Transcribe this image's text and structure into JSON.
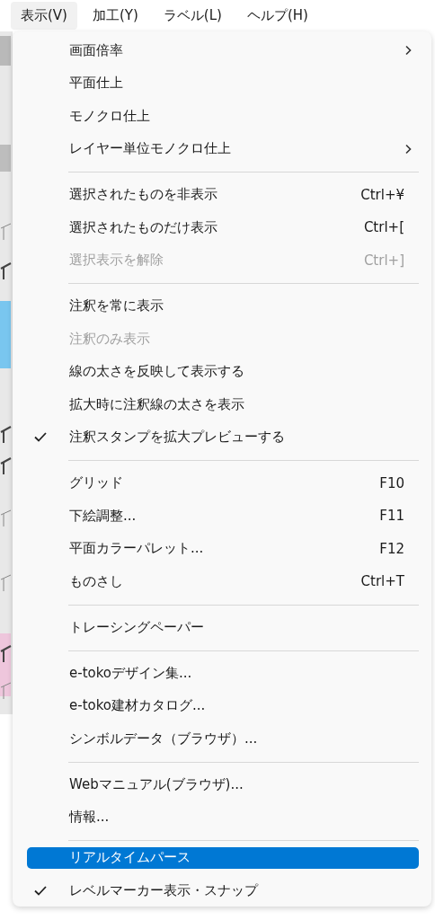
{
  "menubar": [
    {
      "label": "表示(V)",
      "selected": true
    },
    {
      "label": "加工(Y)",
      "selected": false
    },
    {
      "label": "ラベル(L)",
      "selected": false
    },
    {
      "label": "ヘルプ(H)",
      "selected": false
    }
  ],
  "menu": {
    "items": [
      {
        "kind": "item",
        "label": "画面倍率",
        "submenu": true,
        "disabled": false,
        "checked": false,
        "highlighted": false
      },
      {
        "kind": "item",
        "label": "平面仕上",
        "submenu": false,
        "disabled": false,
        "checked": false,
        "highlighted": false
      },
      {
        "kind": "item",
        "label": "モノクロ仕上",
        "submenu": false,
        "disabled": false,
        "checked": false,
        "highlighted": false
      },
      {
        "kind": "item",
        "label": "レイヤー単位モノクロ仕上",
        "submenu": true,
        "disabled": false,
        "checked": false,
        "highlighted": false
      },
      {
        "kind": "separator"
      },
      {
        "kind": "item",
        "label": "選択されたものを非表示",
        "shortcut": "Ctrl+¥",
        "submenu": false,
        "disabled": false,
        "checked": false,
        "highlighted": false
      },
      {
        "kind": "item",
        "label": "選択されたものだけ表示",
        "shortcut": "Ctrl+[",
        "submenu": false,
        "disabled": false,
        "checked": false,
        "highlighted": false
      },
      {
        "kind": "item",
        "label": "選択表示を解除",
        "shortcut": "Ctrl+]",
        "submenu": false,
        "disabled": true,
        "checked": false,
        "highlighted": false
      },
      {
        "kind": "separator"
      },
      {
        "kind": "item",
        "label": "注釈を常に表示",
        "submenu": false,
        "disabled": false,
        "checked": false,
        "highlighted": false
      },
      {
        "kind": "item",
        "label": "注釈のみ表示",
        "submenu": false,
        "disabled": true,
        "checked": false,
        "highlighted": false
      },
      {
        "kind": "item",
        "label": "線の太さを反映して表示する",
        "submenu": false,
        "disabled": false,
        "checked": false,
        "highlighted": false
      },
      {
        "kind": "item",
        "label": "拡大時に注釈線の太さを表示",
        "submenu": false,
        "disabled": false,
        "checked": false,
        "highlighted": false
      },
      {
        "kind": "item",
        "label": "注釈スタンプを拡大プレビューする",
        "submenu": false,
        "disabled": false,
        "checked": true,
        "highlighted": false
      },
      {
        "kind": "separator"
      },
      {
        "kind": "item",
        "label": "グリッド",
        "shortcut": "F10",
        "submenu": false,
        "disabled": false,
        "checked": false,
        "highlighted": false
      },
      {
        "kind": "item",
        "label": "下絵調整...",
        "shortcut": "F11",
        "submenu": false,
        "disabled": false,
        "checked": false,
        "highlighted": false
      },
      {
        "kind": "item",
        "label": "平面カラーパレット...",
        "shortcut": "F12",
        "submenu": false,
        "disabled": false,
        "checked": false,
        "highlighted": false
      },
      {
        "kind": "item",
        "label": "ものさし",
        "shortcut": "Ctrl+T",
        "submenu": false,
        "disabled": false,
        "checked": false,
        "highlighted": false
      },
      {
        "kind": "separator"
      },
      {
        "kind": "item",
        "label": "トレーシングペーパー",
        "submenu": false,
        "disabled": false,
        "checked": false,
        "highlighted": false
      },
      {
        "kind": "separator"
      },
      {
        "kind": "item",
        "label": "e-tokoデザイン集...",
        "submenu": false,
        "disabled": false,
        "checked": false,
        "highlighted": false
      },
      {
        "kind": "item",
        "label": "e-toko建材カタログ...",
        "submenu": false,
        "disabled": false,
        "checked": false,
        "highlighted": false
      },
      {
        "kind": "item",
        "label": "シンボルデータ（ブラウザ）...",
        "submenu": false,
        "disabled": false,
        "checked": false,
        "highlighted": false
      },
      {
        "kind": "separator"
      },
      {
        "kind": "item",
        "label": "Webマニュアル(ブラウザ)...",
        "submenu": false,
        "disabled": false,
        "checked": false,
        "highlighted": false
      },
      {
        "kind": "item",
        "label": "情報...",
        "submenu": false,
        "disabled": false,
        "checked": false,
        "highlighted": false
      },
      {
        "kind": "separator"
      },
      {
        "kind": "item",
        "label": "リアルタイムパース",
        "submenu": false,
        "disabled": false,
        "checked": false,
        "highlighted": true
      },
      {
        "kind": "item",
        "label": "レベルマーカー表示・スナップ",
        "submenu": false,
        "disabled": false,
        "checked": true,
        "highlighted": false
      }
    ]
  }
}
